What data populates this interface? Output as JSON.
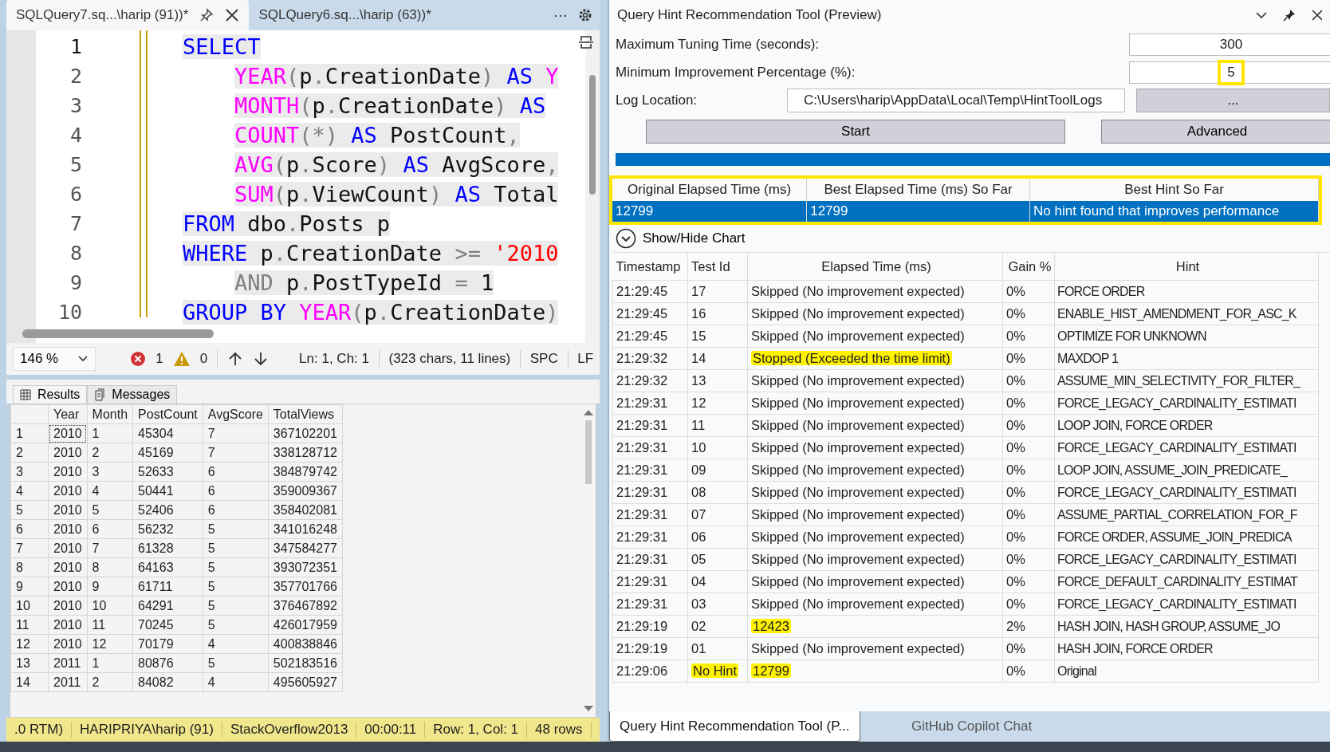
{
  "editor": {
    "tabs": [
      {
        "label": "SQLQuery7.sq...\\harip (91))*",
        "selected": true
      },
      {
        "label": "SQLQuery6.sq...\\harip (63))*",
        "selected": false
      }
    ],
    "tab_overflow": "···",
    "lines": [
      {
        "number": "1",
        "indented": false,
        "tokens": [
          {
            "text": "SELECT",
            "kind": "kw"
          }
        ]
      },
      {
        "number": "2",
        "indented": true,
        "tokens": [
          {
            "text": "YEAR",
            "kind": "fn"
          },
          {
            "text": "(",
            "kind": "op"
          },
          {
            "text": "p",
            "kind": "id"
          },
          {
            "text": ".",
            "kind": "op"
          },
          {
            "text": "CreationDate",
            "kind": "id"
          },
          {
            "text": ")",
            "kind": "op"
          },
          {
            "text": " AS",
            "kind": "kw"
          },
          {
            "text": " Y",
            "kind": "fn"
          }
        ]
      },
      {
        "number": "3",
        "indented": true,
        "tokens": [
          {
            "text": "MONTH",
            "kind": "fn"
          },
          {
            "text": "(",
            "kind": "op"
          },
          {
            "text": "p",
            "kind": "id"
          },
          {
            "text": ".",
            "kind": "op"
          },
          {
            "text": "CreationDate",
            "kind": "id"
          },
          {
            "text": ")",
            "kind": "op"
          },
          {
            "text": " AS",
            "kind": "kw"
          }
        ]
      },
      {
        "number": "4",
        "indented": true,
        "tokens": [
          {
            "text": "COUNT",
            "kind": "fn"
          },
          {
            "text": "(*)",
            "kind": "op"
          },
          {
            "text": " AS",
            "kind": "kw"
          },
          {
            "text": " PostCount",
            "kind": "id"
          },
          {
            "text": ",",
            "kind": "op"
          }
        ]
      },
      {
        "number": "5",
        "indented": true,
        "tokens": [
          {
            "text": "AVG",
            "kind": "fn"
          },
          {
            "text": "(",
            "kind": "op"
          },
          {
            "text": "p",
            "kind": "id"
          },
          {
            "text": ".",
            "kind": "op"
          },
          {
            "text": "Score",
            "kind": "id"
          },
          {
            "text": ")",
            "kind": "op"
          },
          {
            "text": " AS",
            "kind": "kw"
          },
          {
            "text": " AvgScore",
            "kind": "id"
          },
          {
            "text": ",",
            "kind": "op"
          }
        ]
      },
      {
        "number": "6",
        "indented": true,
        "tokens": [
          {
            "text": "SUM",
            "kind": "fn"
          },
          {
            "text": "(",
            "kind": "op"
          },
          {
            "text": "p",
            "kind": "id"
          },
          {
            "text": ".",
            "kind": "op"
          },
          {
            "text": "ViewCount",
            "kind": "id"
          },
          {
            "text": ")",
            "kind": "op"
          },
          {
            "text": " AS",
            "kind": "kw"
          },
          {
            "text": " Total",
            "kind": "id"
          }
        ]
      },
      {
        "number": "7",
        "indented": false,
        "tokens": [
          {
            "text": "FROM",
            "kind": "kw"
          },
          {
            "text": " dbo",
            "kind": "id"
          },
          {
            "text": ".",
            "kind": "op"
          },
          {
            "text": "Posts p",
            "kind": "id"
          }
        ]
      },
      {
        "number": "8",
        "indented": false,
        "tokens": [
          {
            "text": "WHERE",
            "kind": "kw"
          },
          {
            "text": " p",
            "kind": "id"
          },
          {
            "text": ".",
            "kind": "op"
          },
          {
            "text": "CreationDate ",
            "kind": "id"
          },
          {
            "text": ">=",
            "kind": "op"
          },
          {
            "text": " '2010",
            "kind": "str"
          }
        ]
      },
      {
        "number": "9",
        "indented": true,
        "tokens": [
          {
            "text": "AND",
            "kind": "op"
          },
          {
            "text": " p",
            "kind": "id"
          },
          {
            "text": ".",
            "kind": "op"
          },
          {
            "text": "PostTypeId ",
            "kind": "id"
          },
          {
            "text": "=",
            "kind": "op"
          },
          {
            "text": " 1",
            "kind": "id"
          }
        ]
      },
      {
        "number": "10",
        "indented": false,
        "tokens": [
          {
            "text": "GROUP BY",
            "kind": "kw"
          },
          {
            "text": " YEAR",
            "kind": "fn"
          },
          {
            "text": "(",
            "kind": "op"
          },
          {
            "text": "p",
            "kind": "id"
          },
          {
            "text": ".",
            "kind": "op"
          },
          {
            "text": "CreationDate",
            "kind": "id"
          },
          {
            "text": ")",
            "kind": "op"
          }
        ]
      }
    ],
    "status": {
      "zoom": "146 %",
      "errors": "1",
      "warnings": "0",
      "position": "Ln: 1, Ch: 1",
      "size": "(323 chars, 11 lines)",
      "indent": "SPC",
      "line_ending": "LF"
    }
  },
  "results": {
    "tabs": [
      {
        "label": "Results",
        "selected": true
      },
      {
        "label": "Messages",
        "selected": false
      }
    ],
    "columns": [
      "Year",
      "Month",
      "PostCount",
      "AvgScore",
      "TotalViews"
    ],
    "rows": [
      {
        "number": "1",
        "cells": [
          "2010",
          "1",
          "45304",
          "7",
          "367102201"
        ],
        "focused": true
      },
      {
        "number": "2",
        "cells": [
          "2010",
          "2",
          "45169",
          "7",
          "338128712"
        ],
        "focused": false
      },
      {
        "number": "3",
        "cells": [
          "2010",
          "3",
          "52633",
          "6",
          "384879742"
        ],
        "focused": false
      },
      {
        "number": "4",
        "cells": [
          "2010",
          "4",
          "50441",
          "6",
          "359009367"
        ],
        "focused": false
      },
      {
        "number": "5",
        "cells": [
          "2010",
          "5",
          "52406",
          "6",
          "358402081"
        ],
        "focused": false
      },
      {
        "number": "6",
        "cells": [
          "2010",
          "6",
          "56232",
          "5",
          "341016248"
        ],
        "focused": false
      },
      {
        "number": "7",
        "cells": [
          "2010",
          "7",
          "61328",
          "5",
          "347584277"
        ],
        "focused": false
      },
      {
        "number": "8",
        "cells": [
          "2010",
          "8",
          "64163",
          "5",
          "393072351"
        ],
        "focused": false
      },
      {
        "number": "9",
        "cells": [
          "2010",
          "9",
          "61711",
          "5",
          "357701766"
        ],
        "focused": false
      },
      {
        "number": "10",
        "cells": [
          "2010",
          "10",
          "64291",
          "5",
          "376467892"
        ],
        "focused": false
      },
      {
        "number": "11",
        "cells": [
          "2010",
          "11",
          "70245",
          "5",
          "426017959"
        ],
        "focused": false
      },
      {
        "number": "12",
        "cells": [
          "2010",
          "12",
          "70179",
          "4",
          "400838846"
        ],
        "focused": false
      },
      {
        "number": "13",
        "cells": [
          "2011",
          "1",
          "80876",
          "5",
          "502183516"
        ],
        "focused": false
      },
      {
        "number": "14",
        "cells": [
          "2011",
          "2",
          "84082",
          "4",
          "495605927"
        ],
        "focused": false
      }
    ]
  },
  "status_bar": [
    ".0 RTM)",
    "HARIPRIYA\\harip (91)",
    "StackOverflow2013",
    "00:00:11",
    "Row: 1, Col: 1",
    "48 rows"
  ],
  "tool": {
    "title": "Query Hint Recommendation Tool (Preview)",
    "fields": [
      {
        "label": "Maximum Tuning Time (seconds):",
        "value": "300",
        "annotated": false
      },
      {
        "label": "Minimum Improvement Percentage (%):",
        "value": "5",
        "annotated": true
      }
    ],
    "log": {
      "label": "Log Location:",
      "value": "C:\\Users\\harip\\AppData\\Local\\Temp\\HintToolLogs",
      "browse": "..."
    },
    "buttons": [
      "Start",
      "Advanced"
    ],
    "progress": {
      "level": 1
    },
    "summary": {
      "annotated": true,
      "columns": [
        "Original Elapsed Time (ms)",
        "Best Elapsed Time (ms) So Far",
        "Best Hint So Far"
      ],
      "row": {
        "cells": [
          "12799",
          "12799",
          "No hint found that improves performance"
        ],
        "selected": true
      }
    },
    "chart_toggle": "Show/Hide Chart",
    "columns": [
      "Timestamp",
      "Test Id",
      "Elapsed Time (ms)",
      "Gain %",
      "Hint"
    ],
    "rows": [
      {
        "timestamp": "21:29:45",
        "test_id": "17",
        "elapsed": "Skipped (No improvement expected)",
        "gain": "0%",
        "hint": "FORCE ORDER",
        "test_id_highlighted": false,
        "elapsed_highlighted": false
      },
      {
        "timestamp": "21:29:45",
        "test_id": "16",
        "elapsed": "Skipped (No improvement expected)",
        "gain": "0%",
        "hint": "ENABLE_HIST_AMENDMENT_FOR_ASC_K",
        "test_id_highlighted": false,
        "elapsed_highlighted": false
      },
      {
        "timestamp": "21:29:45",
        "test_id": "15",
        "elapsed": "Skipped (No improvement expected)",
        "gain": "0%",
        "hint": "OPTIMIZE FOR UNKNOWN",
        "test_id_highlighted": false,
        "elapsed_highlighted": false
      },
      {
        "timestamp": "21:29:32",
        "test_id": "14",
        "elapsed": "Stopped (Exceeded the time limit)",
        "gain": "0%",
        "hint": "MAXDOP 1",
        "test_id_highlighted": false,
        "elapsed_highlighted": true
      },
      {
        "timestamp": "21:29:32",
        "test_id": "13",
        "elapsed": "Skipped (No improvement expected)",
        "gain": "0%",
        "hint": "ASSUME_MIN_SELECTIVITY_FOR_FILTER_",
        "test_id_highlighted": false,
        "elapsed_highlighted": false
      },
      {
        "timestamp": "21:29:31",
        "test_id": "12",
        "elapsed": "Skipped (No improvement expected)",
        "gain": "0%",
        "hint": "FORCE_LEGACY_CARDINALITY_ESTIMATI",
        "test_id_highlighted": false,
        "elapsed_highlighted": false
      },
      {
        "timestamp": "21:29:31",
        "test_id": "11",
        "elapsed": "Skipped (No improvement expected)",
        "gain": "0%",
        "hint": "LOOP JOIN, FORCE ORDER",
        "test_id_highlighted": false,
        "elapsed_highlighted": false
      },
      {
        "timestamp": "21:29:31",
        "test_id": "10",
        "elapsed": "Skipped (No improvement expected)",
        "gain": "0%",
        "hint": "FORCE_LEGACY_CARDINALITY_ESTIMATI",
        "test_id_highlighted": false,
        "elapsed_highlighted": false
      },
      {
        "timestamp": "21:29:31",
        "test_id": "09",
        "elapsed": "Skipped (No improvement expected)",
        "gain": "0%",
        "hint": "LOOP JOIN,  ASSUME_JOIN_PREDICATE_",
        "test_id_highlighted": false,
        "elapsed_highlighted": false
      },
      {
        "timestamp": "21:29:31",
        "test_id": "08",
        "elapsed": "Skipped (No improvement expected)",
        "gain": "0%",
        "hint": "FORCE_LEGACY_CARDINALITY_ESTIMATI",
        "test_id_highlighted": false,
        "elapsed_highlighted": false
      },
      {
        "timestamp": "21:29:31",
        "test_id": "07",
        "elapsed": "Skipped (No improvement expected)",
        "gain": "0%",
        "hint": "ASSUME_PARTIAL_CORRELATION_FOR_F",
        "test_id_highlighted": false,
        "elapsed_highlighted": false
      },
      {
        "timestamp": "21:29:31",
        "test_id": "06",
        "elapsed": "Skipped (No improvement expected)",
        "gain": "0%",
        "hint": "FORCE ORDER,  ASSUME_JOIN_PREDICA",
        "test_id_highlighted": false,
        "elapsed_highlighted": false
      },
      {
        "timestamp": "21:29:31",
        "test_id": "05",
        "elapsed": "Skipped (No improvement expected)",
        "gain": "0%",
        "hint": "FORCE_LEGACY_CARDINALITY_ESTIMATI",
        "test_id_highlighted": false,
        "elapsed_highlighted": false
      },
      {
        "timestamp": "21:29:31",
        "test_id": "04",
        "elapsed": "Skipped (No improvement expected)",
        "gain": "0%",
        "hint": "FORCE_DEFAULT_CARDINALITY_ESTIMAT",
        "test_id_highlighted": false,
        "elapsed_highlighted": false
      },
      {
        "timestamp": "21:29:31",
        "test_id": "03",
        "elapsed": "Skipped (No improvement expected)",
        "gain": "0%",
        "hint": "FORCE_LEGACY_CARDINALITY_ESTIMATI",
        "test_id_highlighted": false,
        "elapsed_highlighted": false
      },
      {
        "timestamp": "21:29:19",
        "test_id": "02",
        "elapsed": "12423",
        "gain": "2%",
        "hint": "HASH JOIN, HASH GROUP,  ASSUME_JO",
        "test_id_highlighted": false,
        "elapsed_highlighted": true
      },
      {
        "timestamp": "21:29:19",
        "test_id": "01",
        "elapsed": "Skipped (No improvement expected)",
        "gain": "0%",
        "hint": "HASH JOIN, FORCE ORDER",
        "test_id_highlighted": false,
        "elapsed_highlighted": false
      },
      {
        "timestamp": "21:29:06",
        "test_id": "No Hint",
        "elapsed": "12799",
        "gain": "0%",
        "hint": "Original",
        "test_id_highlighted": true,
        "elapsed_highlighted": true
      }
    ],
    "bottom_tabs": [
      {
        "label": "Query Hint Recommendation Tool (P...",
        "selected": true
      },
      {
        "label": "GitHub Copilot Chat",
        "selected": false
      }
    ]
  }
}
